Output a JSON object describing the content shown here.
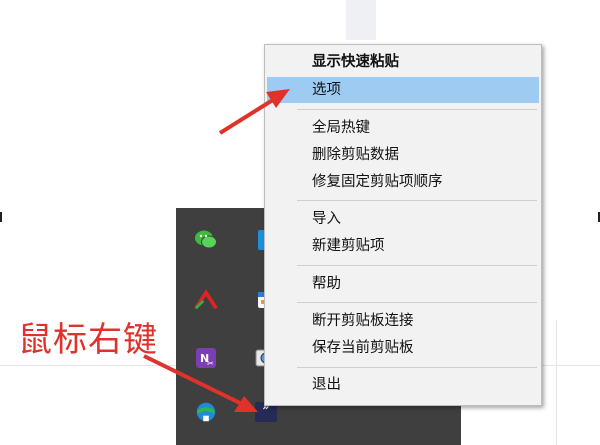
{
  "context_menu": {
    "items": [
      {
        "label": "显示快速粘贴",
        "bold": true,
        "highlighted": false
      },
      {
        "label": "选项",
        "bold": false,
        "highlighted": true
      },
      {
        "label": "全局热键"
      },
      {
        "label": "删除剪贴数据"
      },
      {
        "label": "修复固定剪贴项顺序"
      },
      {
        "label": "导入"
      },
      {
        "label": "新建剪贴项"
      },
      {
        "label": "帮助"
      },
      {
        "label": "断开剪贴板连接"
      },
      {
        "label": "保存当前剪贴板"
      },
      {
        "label": "退出"
      }
    ]
  },
  "annotation": {
    "text": "鼠标右键",
    "color": "#e0322a"
  },
  "tray": {
    "icons": [
      "wechat-icon",
      "app-blue-icon",
      "red-triangle-icon",
      "calendar-icon",
      "onenote-icon",
      "camera-icon",
      "network-globe-icon",
      "clipboard-app-icon"
    ]
  },
  "colors": {
    "menu_background": "#f2f2f2",
    "highlight": "#9dcbf2",
    "tray_background": "#3f3f3f",
    "arrow": "#e0322a"
  }
}
